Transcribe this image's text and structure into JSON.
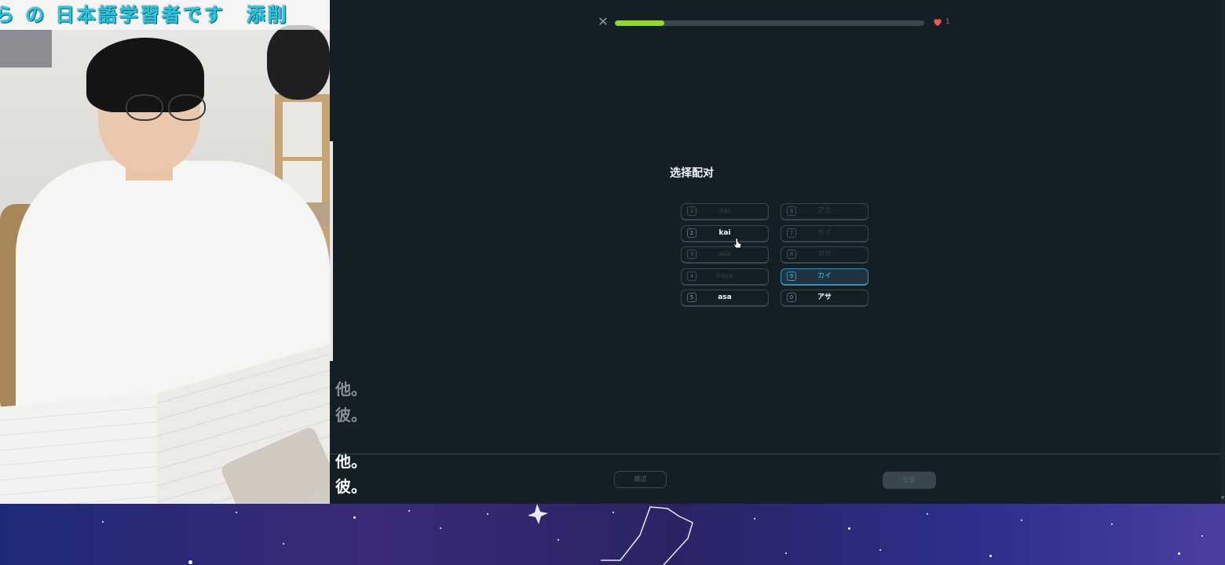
{
  "webcam": {
    "banner_text": "ら の 日本語学習者です　添削"
  },
  "lesson": {
    "progress_fraction": 0.16,
    "hearts": "1",
    "prompt_title": "选择配对",
    "left_column": [
      {
        "key": "1",
        "text": "sai",
        "state": "disabled"
      },
      {
        "key": "2",
        "text": "kai",
        "state": "active"
      },
      {
        "key": "3",
        "text": "aka",
        "state": "disabled"
      },
      {
        "key": "4",
        "text": "kasa",
        "state": "disabled"
      },
      {
        "key": "5",
        "text": "asa",
        "state": "active"
      }
    ],
    "right_column": [
      {
        "key": "6",
        "text": "アカ",
        "state": "disabled"
      },
      {
        "key": "7",
        "text": "サイ",
        "state": "disabled"
      },
      {
        "key": "8",
        "text": "カサ",
        "state": "disabled"
      },
      {
        "key": "9",
        "text": "カイ",
        "state": "selected"
      },
      {
        "key": "0",
        "text": "アサ",
        "state": "active"
      }
    ],
    "skip_label": "跳过",
    "check_label": "检查"
  },
  "overlay": {
    "upper_line1": "他。",
    "upper_line2": "彼。",
    "lower_line1": "他。",
    "lower_line2": "彼。"
  },
  "colors": {
    "background": "#131f24",
    "progress": "#93d333",
    "heart": "#ee5555",
    "selected_accent": "#49c0f8"
  }
}
